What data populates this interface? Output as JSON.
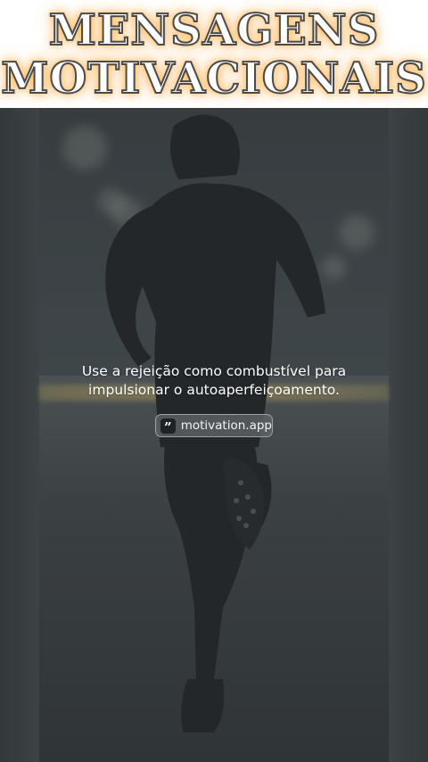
{
  "header": {
    "line1": "MENSAGENS",
    "line2": "MOTIVACIONAIS"
  },
  "quote": {
    "text_line1": "Use a rejeição como combustível para",
    "text_line2": "impulsionar o autoaperfeiçoamento."
  },
  "badge": {
    "icon": "quote-mark-icon",
    "icon_glyph": "”",
    "label": "motivation.app"
  },
  "colors": {
    "header_text": "#ffffff",
    "header_glow": "#ffaa3c",
    "scene_bg": "#4a5256"
  }
}
